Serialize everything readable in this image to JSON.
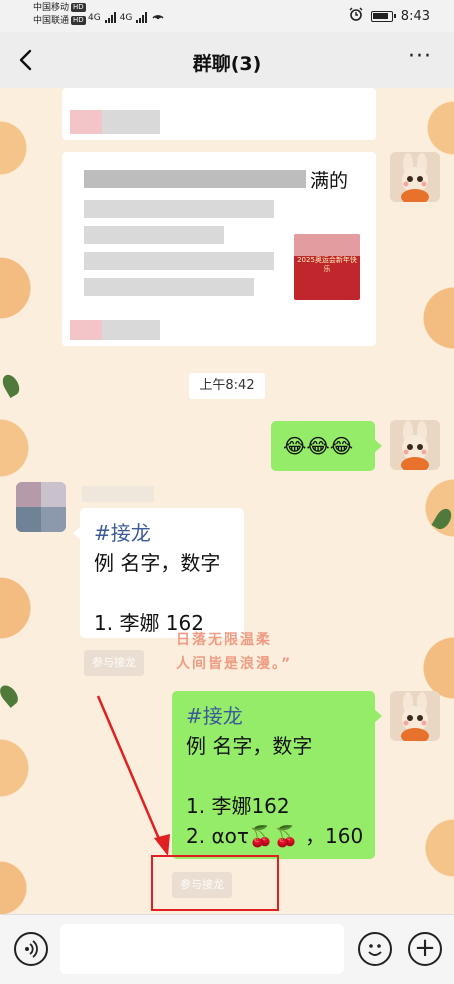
{
  "status_bar": {
    "carrier1": "中国移动",
    "carrier2": "中国联通",
    "hd": "HD",
    "network1": "4G",
    "network2": "4G",
    "time": "8:43",
    "alarm_icon": "alarm-icon",
    "battery_icon": "battery-icon",
    "wifi_icon": "hotspot-icon"
  },
  "nav": {
    "title": "群聊(3)",
    "back_icon": "back-arrow-icon",
    "more_label": "···"
  },
  "chat": {
    "shared_card": {
      "title_tail": "满的",
      "thumbnail_text": "2025奥运会新年快乐"
    },
    "time_label": "上午8:42",
    "emoji_message": "😂😂😂",
    "incoming": {
      "line1": "#接龙",
      "line2": "例 名字，数字",
      "line3": "",
      "line4": "1. 李娜 162",
      "join_label": "参与接龙"
    },
    "wallpaper_text": {
      "line1": "日落无限温柔",
      "line2": "人间皆是浪漫。”"
    },
    "outgoing": {
      "line1": "#接龙",
      "line2": "例 名字，数字",
      "line3": "",
      "line4": "1. 李娜162",
      "line5": "2. αoτ🍒🍒 ，160",
      "join_label": "参与接龙"
    }
  },
  "input_bar": {
    "voice_icon": "voice-icon",
    "emoji_icon": "emoji-icon",
    "plus_icon": "plus-icon",
    "value": "",
    "placeholder": ""
  },
  "colors": {
    "green_bubble": "#95ec69",
    "annotation_red": "#e02020",
    "hashtag_blue": "#3a5a98"
  }
}
